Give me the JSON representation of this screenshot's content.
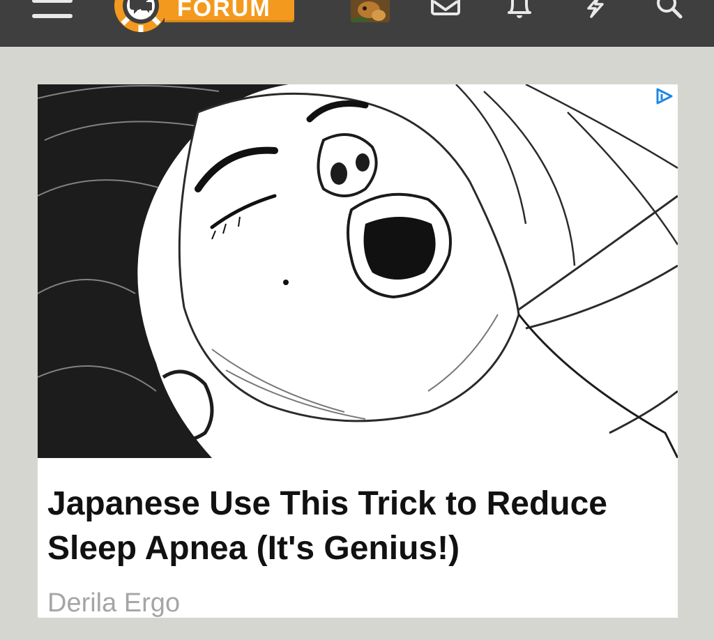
{
  "header": {
    "logo_text": "FORUM",
    "icons": [
      "menu-icon",
      "avatar",
      "mail-icon",
      "bell-icon",
      "alerts-bolt-icon",
      "search-icon"
    ],
    "colors": {
      "bar": "#3f3f3f",
      "logo_orange": "#f39a1e",
      "icon": "#e9e9e9"
    }
  },
  "ad": {
    "image_alt": "",
    "headline": "Japanese Use This Trick to Reduce Sleep Apnea (It's Genius!)",
    "sponsor": "Derila Ergo",
    "adchoices_icon": "adchoices-icon",
    "colors": {
      "adchoices": "#1e88e5",
      "sponsor_text": "#a5a5a5"
    }
  }
}
